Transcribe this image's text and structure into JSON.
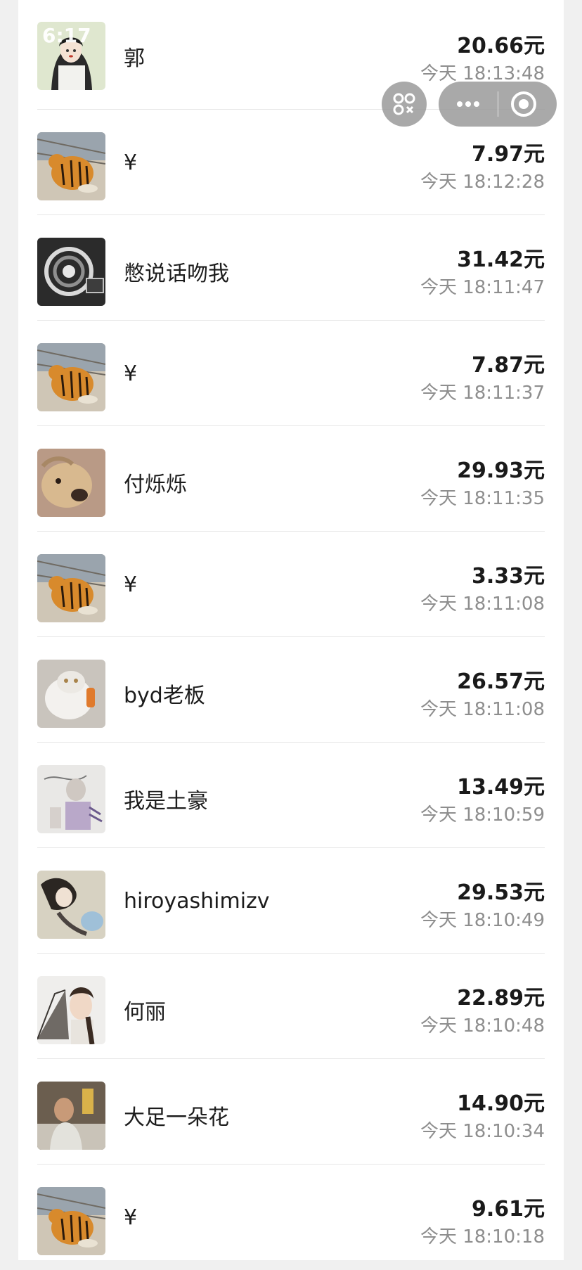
{
  "status_bar": {
    "time": "6:17"
  },
  "capsule": {
    "scan_icon": "scan-grid-icon",
    "more_icon": "more-dots-icon",
    "close_icon": "target-close-icon"
  },
  "records": [
    {
      "name": "郭",
      "amount": "20.66元",
      "time": "今天 18:13:48",
      "avatar": "girl-illustration"
    },
    {
      "name": "¥",
      "amount": "7.97元",
      "time": "今天 18:12:28",
      "avatar": "tiger"
    },
    {
      "name": "憋说话吻我",
      "amount": "31.42元",
      "time": "今天 18:11:47",
      "avatar": "bw-abstract"
    },
    {
      "name": "¥",
      "amount": "7.87元",
      "time": "今天 18:11:37",
      "avatar": "tiger"
    },
    {
      "name": "付烁烁",
      "amount": "29.93元",
      "time": "今天 18:11:35",
      "avatar": "puppy"
    },
    {
      "name": "¥",
      "amount": "3.33元",
      "time": "今天 18:11:08",
      "avatar": "tiger"
    },
    {
      "name": "byd老板",
      "amount": "26.57元",
      "time": "今天 18:11:08",
      "avatar": "white-cat"
    },
    {
      "name": "我是土豪",
      "amount": "13.49元",
      "time": "今天 18:10:59",
      "avatar": "sketch-art"
    },
    {
      "name": "hiroyashimizv",
      "amount": "29.53元",
      "time": "今天 18:10:49",
      "avatar": "anime-figure"
    },
    {
      "name": "何丽",
      "amount": "22.89元",
      "time": "今天 18:10:48",
      "avatar": "woman-fan"
    },
    {
      "name": "大足一朵花",
      "amount": "14.90元",
      "time": "今天 18:10:34",
      "avatar": "man-portrait"
    },
    {
      "name": "¥",
      "amount": "9.61元",
      "time": "今天 18:10:18",
      "avatar": "tiger"
    }
  ]
}
